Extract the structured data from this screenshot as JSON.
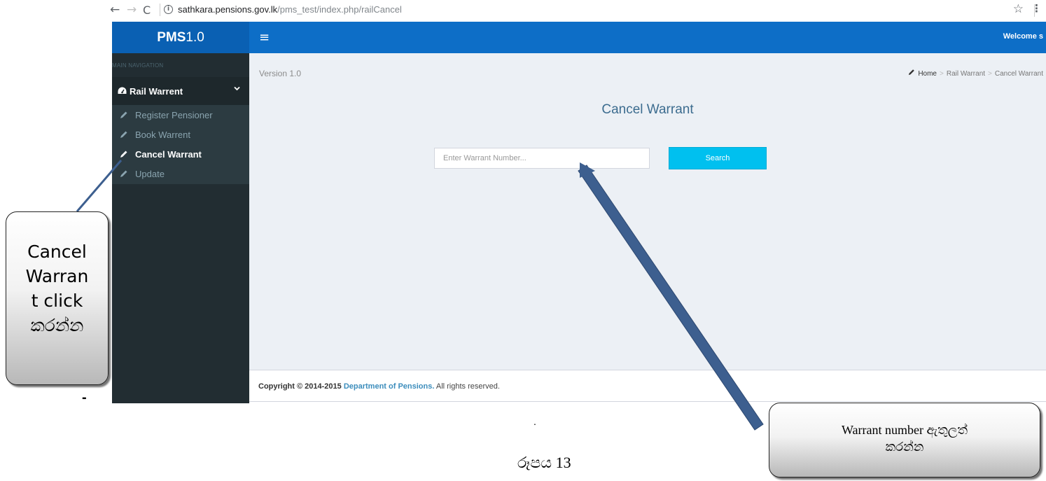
{
  "browser": {
    "url_host": "sathkara.pensions.gov.lk",
    "url_path": "/pms_test/index.php/railCancel",
    "back_glyph": "←",
    "forward_glyph": "→",
    "reload_glyph": "C",
    "info_glyph": "i",
    "star_glyph": "☆",
    "menu_glyph": "⋮"
  },
  "header": {
    "logo_bold": "PMS",
    "logo_rest": "1.0",
    "hamburger_glyph": "≡",
    "welcome": "Welcome s"
  },
  "sidebar": {
    "header": "MAIN NAVIGATION",
    "menu": {
      "label": "Rail Warrent",
      "icon": "dashboard-icon",
      "chevron": "⌄"
    },
    "items": [
      {
        "label": "Register Pensioner",
        "icon": "pencil-icon",
        "active": false
      },
      {
        "label": "Book Warrent",
        "icon": "pencil-icon",
        "active": false
      },
      {
        "label": "Cancel Warrant",
        "icon": "pencil-icon",
        "active": true
      },
      {
        "label": "Update",
        "icon": "pencil-icon",
        "active": false
      }
    ]
  },
  "content": {
    "version": "Version 1.0",
    "breadcrumb": [
      "Home",
      "Rail Warrant",
      "Cancel Warrant"
    ],
    "breadcrumb_sep": ">",
    "title": "Cancel Warrant",
    "search": {
      "placeholder": "Enter Warrant Number...",
      "value": "",
      "button": "Search"
    }
  },
  "footer": {
    "prefix": "Copyright © 2014-2015",
    "link": "Department of Pensions.",
    "suffix": "All rights reserved."
  },
  "annotations": {
    "left_callout": "Cancel\nWarran\nt click\nකරන්න",
    "right_callout": "Warrant number ඇතුලත්\nකරන්න",
    "dash": "-",
    "dot": ".",
    "caption": "රූපය 13"
  },
  "colors": {
    "header_blue": "#0d6ec7",
    "logo_blue": "#0a60b3",
    "sidebar_dark": "#222d32",
    "search_button": "#00c0ef",
    "arrow_blue": "#3d5f8f"
  }
}
